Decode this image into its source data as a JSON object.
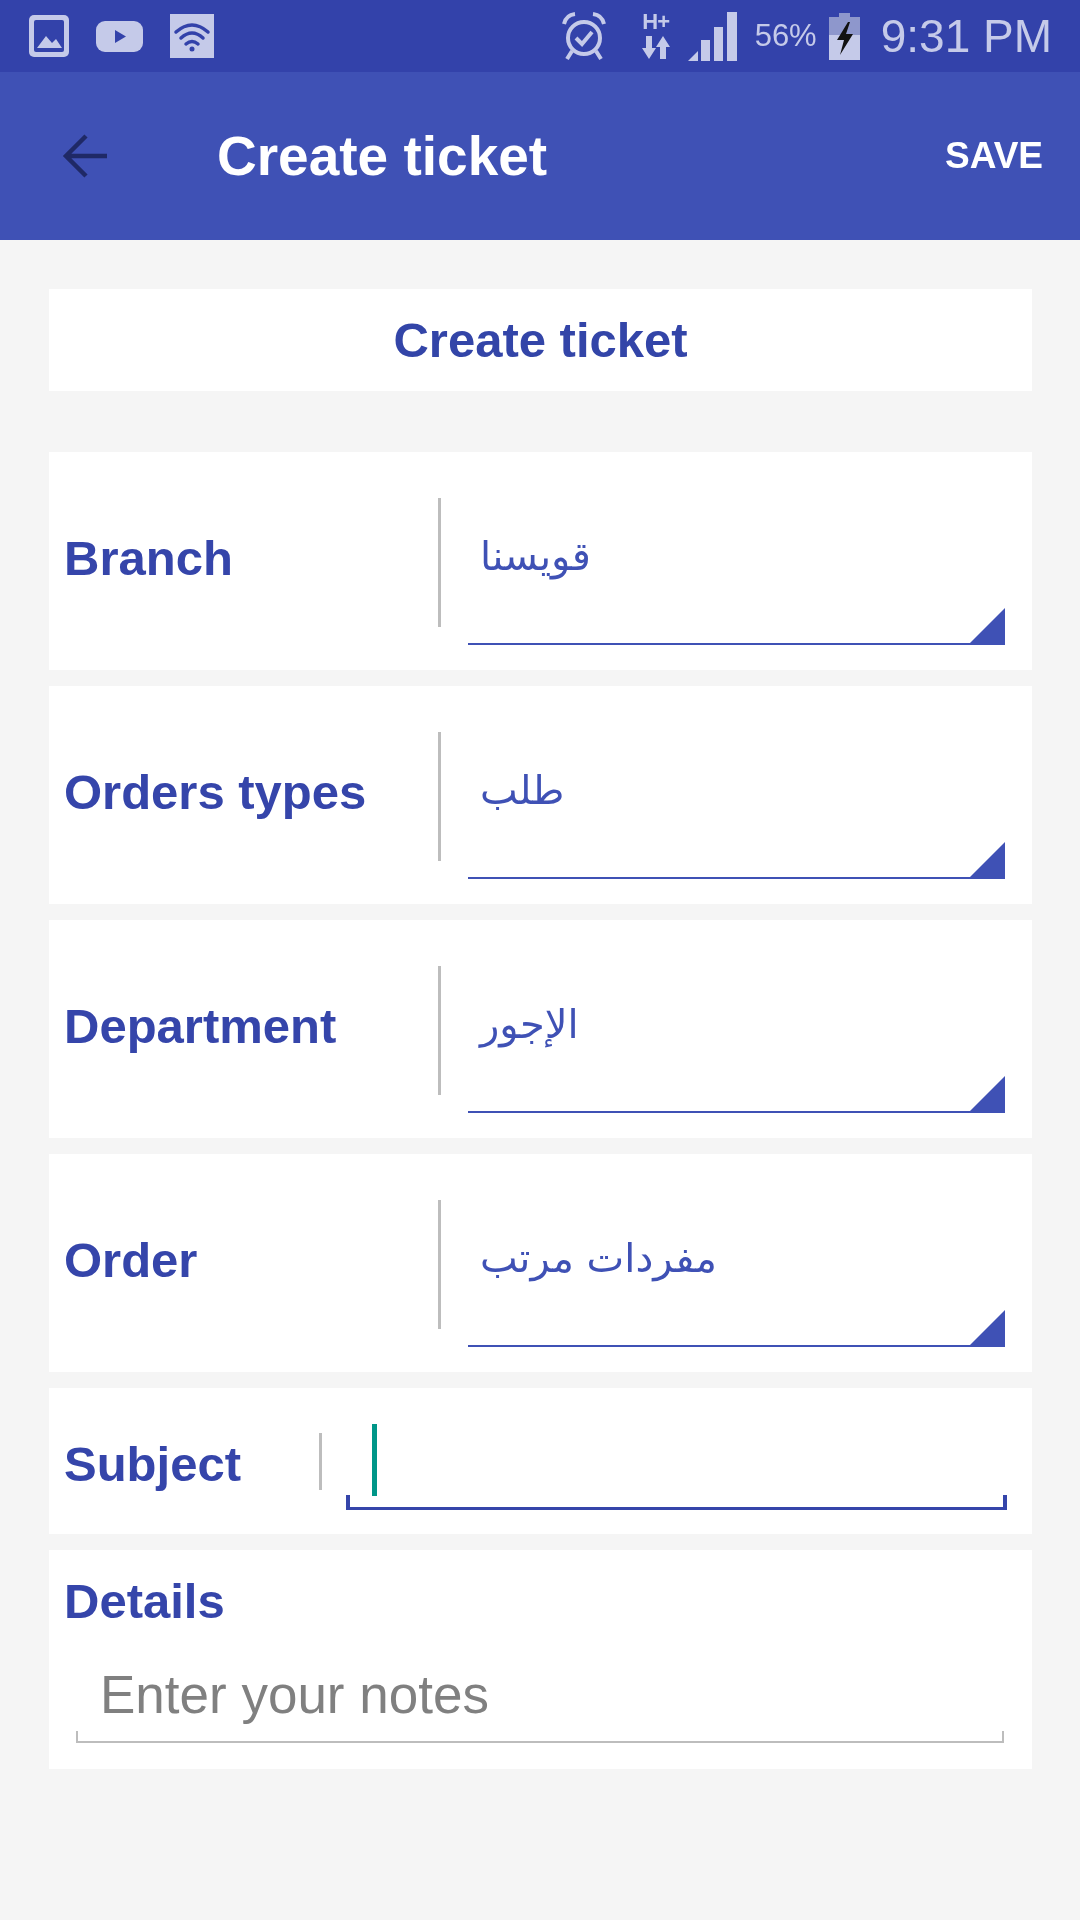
{
  "status_bar": {
    "network_type": "H+",
    "battery": "56%",
    "time": "9:31 PM"
  },
  "app_bar": {
    "title": "Create ticket",
    "action": "SAVE"
  },
  "header": {
    "title": "Create ticket"
  },
  "form": {
    "fields": [
      {
        "kind": "dropdown",
        "label": "Branch",
        "value": "قويسنا"
      },
      {
        "kind": "dropdown",
        "label": "Orders types",
        "value": "طلب"
      },
      {
        "kind": "dropdown",
        "label": "Department",
        "value": "الإجور"
      },
      {
        "kind": "dropdown",
        "label": "Order",
        "value": "مفردات مرتب"
      },
      {
        "kind": "text",
        "label": "Subject",
        "focused": true
      },
      {
        "kind": "textarea",
        "label": "Details",
        "placeholder": "Enter your notes",
        "focused": false
      }
    ]
  }
}
